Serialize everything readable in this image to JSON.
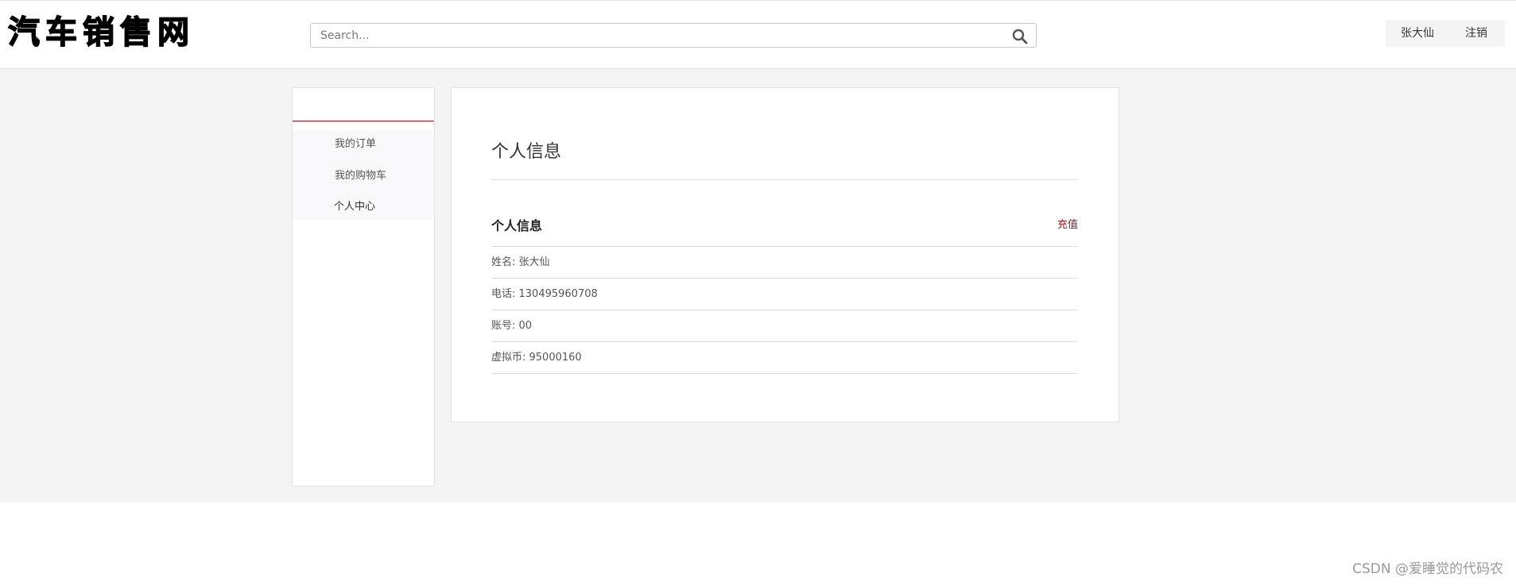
{
  "header": {
    "logo_text": "汽车销售网",
    "search": {
      "placeholder": "Search...",
      "value": ""
    },
    "user": {
      "name_label": "张大仙",
      "logout_label": "注销"
    }
  },
  "sidebar": {
    "items": [
      {
        "label": "我的订单"
      },
      {
        "label": "我的购物车"
      },
      {
        "label": "个人中心"
      }
    ]
  },
  "main": {
    "page_title": "个人信息",
    "section_title": "个人信息",
    "recharge_label": "充值",
    "info_rows": [
      {
        "text": "姓名: 张大仙"
      },
      {
        "text": "电话: 130495960708"
      },
      {
        "text": "账号: 00"
      },
      {
        "text": "虚拟币: 95000160"
      }
    ]
  },
  "watermark": "CSDN @爱睡觉的代码农",
  "colors": {
    "accent": "#a5151b",
    "page_background": "#f4f4f4",
    "card_background": "#ffffff"
  },
  "icons": {
    "search": "search-icon"
  }
}
